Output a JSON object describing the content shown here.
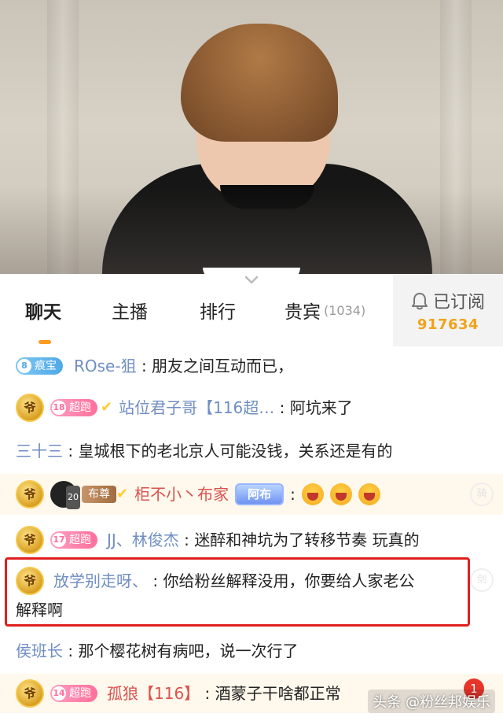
{
  "tabs": {
    "chat": "聊天",
    "host": "主播",
    "rank": "排行",
    "vip": "贵宾",
    "vip_count": "(1034)"
  },
  "subscribe": {
    "label": "已订阅",
    "count": "917634"
  },
  "messages": [
    {
      "level": "8",
      "badge": "痕宝",
      "name": "ROse-狙",
      "text": "朋友之间互动而已，"
    },
    {
      "noble": "爷",
      "level": "18",
      "badge": "超跑",
      "name": "站位君子哥【116超…",
      "text": "阿坑来了"
    },
    {
      "name": "三十三",
      "text": "皇城根下的老北京人可能没钱，关系还是有的"
    },
    {
      "noble": "爷",
      "avatar_level": "20",
      "badge": "布尊",
      "name": "柜不小丶布家",
      "fan_badge": "阿布",
      "text": ":"
    },
    {
      "noble": "爷",
      "level": "17",
      "badge": "超跑",
      "name": "JJ、林俊杰",
      "text": "迷醉和神坑为了转移节奏  玩真的"
    },
    {
      "noble": "爷",
      "name": "放学别走呀、",
      "text_line1": "你给粉丝解释没用，你要给人家老公",
      "text_line2": "解释啊"
    },
    {
      "name": "侯班长",
      "text": "那个樱花树有病吧，说一次行了"
    },
    {
      "noble": "爷",
      "level": "14",
      "badge": "超跑",
      "name": "孤狼【116】",
      "text": "酒蒙子干啥都正常"
    }
  ],
  "notification_count": "1",
  "watermark": "头条 @粉丝邦娱乐",
  "colors": {
    "accent": "#ff9a1f",
    "name": "#6f8ec3",
    "highlight_border": "#e02020",
    "subscribe_count": "#f0a21a"
  }
}
